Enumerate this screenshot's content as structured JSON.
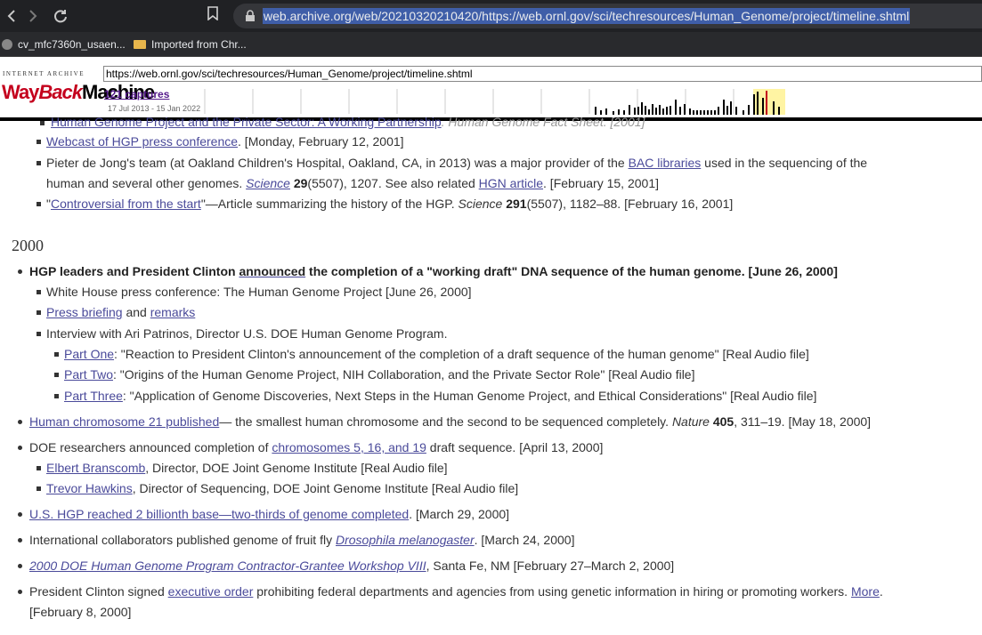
{
  "browser": {
    "url": "web.archive.org/web/20210320210420/https://web.ornl.gov/sci/techresources/Human_Genome/project/timeline.shtml",
    "bookmarks": [
      "cv_mfc7360n_usaen...",
      "Imported from Chr..."
    ]
  },
  "wayback": {
    "brand_small": "INTERNET ARCHIVE",
    "logo_way": "Way",
    "logo_back": "Back",
    "logo_machine": "Machine",
    "url": "https://web.ornl.gov/sci/techresources/Human_Genome/project/timeline.shtml",
    "captures": "121 captures",
    "range": "17 Jul 2013 - 15 Jan 2022"
  },
  "content": {
    "top_partial": {
      "link": "Human Genome Project and the Private Sector: A Working Partnership",
      "rest": ". Human Genome Fact Sheet. [2001]"
    },
    "item_webcast": {
      "link": "Webcast of HGP press conference",
      "rest": ". [Monday, February 12, 2001]"
    },
    "item_dejong": {
      "line1_a": "Pieter de Jong's team (at Oakland Children's Hospital, Oakland, CA, in 2013) was a major provider of the ",
      "line1_link": "BAC libraries",
      "line1_b": " used in the sequencing of the",
      "line2_a": "human and several other genomes. ",
      "line2_journal": "Science",
      "line2_vol": "29",
      "line2_b": "(5507), 1207. See also related ",
      "line2_link": "HGN article",
      "line2_c": ". [February 15, 2001]"
    },
    "item_controversial": {
      "q1": "\"",
      "link": "Controversial from the start",
      "a": "\"—Article summarizing the history of the HGP. ",
      "journal": "Science",
      "vol": "291",
      "b": "(5507), 1182–88. [February 16, 2001]"
    },
    "year": "2000",
    "headline": {
      "a": "HGP leaders and President Clinton ",
      "link": "announced",
      "b": " the completion of a \"working draft\" DNA sequence of the human genome. [June 26, 2000]"
    },
    "whitehouse": "White House press conference: The Human Genome Project [June 26, 2000]",
    "press": {
      "link1": "Press briefing",
      "and": " and ",
      "link2": "remarks"
    },
    "interview": "Interview with Ari Patrinos, Director U.S. DOE Human Genome Program.",
    "part1": {
      "link": "Part One",
      "rest": ": \"Reaction to President Clinton's announcement of the completion of a draft sequence of the human genome\" [Real Audio file]"
    },
    "part2": {
      "link": "Part Two",
      "rest": ": \"Origins of the Human Genome Project, NIH Collaboration, and the Private Sector Role\" [Real Audio file]"
    },
    "part3": {
      "link": "Part Three",
      "rest": ": \"Application of Genome Discoveries, Next Steps in the Human Genome Project, and Ethical Considerations\" [Real Audio file]"
    },
    "chr21": {
      "link": "Human chromosome 21 published",
      "a": "— the smallest human chromosome and the second to be sequenced completely. ",
      "journal": "Nature",
      "vol": "405",
      "b": ", 311–19. [May 18, 2000]"
    },
    "doe": {
      "a": "DOE researchers announced completion of ",
      "link": "chromosomes 5, 16, and 19",
      "b": " draft sequence. [April 13, 2000]"
    },
    "branscomb": {
      "link": "Elbert Branscomb",
      "rest": ", Director, DOE Joint Genome Institute [Real Audio file]"
    },
    "hawkins": {
      "link": "Trevor Hawkins",
      "rest": ", Director of Sequencing, DOE Joint Genome Institute [Real Audio file]"
    },
    "billionth": {
      "link": "U.S. HGP reached 2 billionth base—two-thirds of genome completed",
      "rest": ". [March 29, 2000]"
    },
    "fruitfly": {
      "a": "International collaborators published genome of fruit fly ",
      "link": "Drosophila melanogaster",
      "b": ". [March 24, 2000]"
    },
    "workshop": {
      "link": "2000 DOE Human Genome Program Contractor-Grantee Workshop VIII",
      "rest": ", Santa Fe, NM [February 27–March 2, 2000]"
    },
    "clinton": {
      "a": "President Clinton signed ",
      "link": "executive order",
      "b": " prohibiting federal departments and agencies from using genetic information in hiring or promoting workers. ",
      "more": "More",
      "c": ".",
      "line2": "[February 8, 2000]"
    }
  }
}
